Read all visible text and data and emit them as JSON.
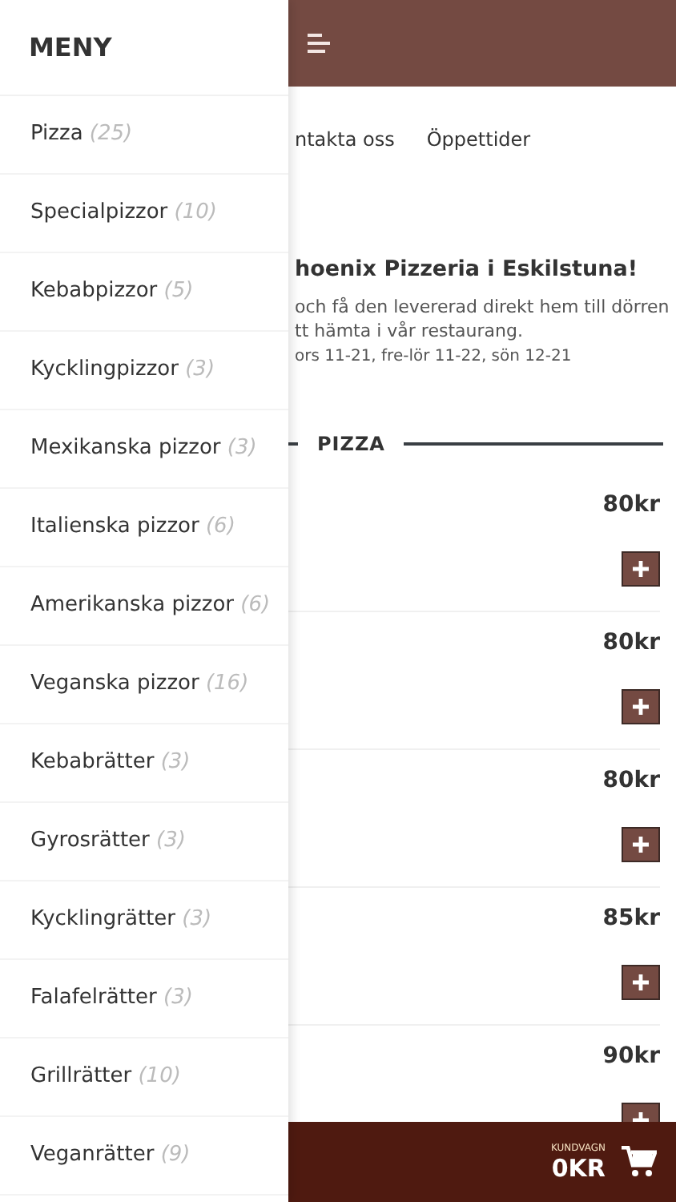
{
  "menu": {
    "title": "MENY",
    "categories": [
      {
        "name": "Pizza",
        "count": "(25)"
      },
      {
        "name": "Specialpizzor",
        "count": "(10)"
      },
      {
        "name": "Kebabpizzor",
        "count": "(5)"
      },
      {
        "name": "Kycklingpizzor",
        "count": "(3)"
      },
      {
        "name": "Mexikanska pizzor",
        "count": "(3)"
      },
      {
        "name": "Italienska pizzor",
        "count": "(6)"
      },
      {
        "name": "Amerikanska pizzor",
        "count": "(6)"
      },
      {
        "name": "Veganska pizzor",
        "count": "(16)"
      },
      {
        "name": "Kebabrätter",
        "count": "(3)"
      },
      {
        "name": "Gyrosrätter",
        "count": "(3)"
      },
      {
        "name": "Kycklingrätter",
        "count": "(3)"
      },
      {
        "name": "Falafelrätter",
        "count": "(3)"
      },
      {
        "name": "Grillrätter",
        "count": "(10)"
      },
      {
        "name": "Veganrätter",
        "count": "(9)"
      }
    ]
  },
  "nav": [
    "ntakta oss",
    "Öppettider"
  ],
  "intro": {
    "heading": "hoenix Pizzeria i Eskilstuna!",
    "lines": [
      "och få den levererad direkt hem till dörren",
      "tt hämta i vår restaurang."
    ],
    "hours": "ors 11-21, fre-lör 11-22, sön 12-21"
  },
  "section": {
    "title": "PIZZA"
  },
  "products": [
    {
      "price": "80kr"
    },
    {
      "price": "80kr"
    },
    {
      "price": "80kr"
    },
    {
      "price": "85kr"
    },
    {
      "price": "90kr"
    }
  ],
  "cart": {
    "label": "KUNDVAGN",
    "total": "0KR"
  }
}
